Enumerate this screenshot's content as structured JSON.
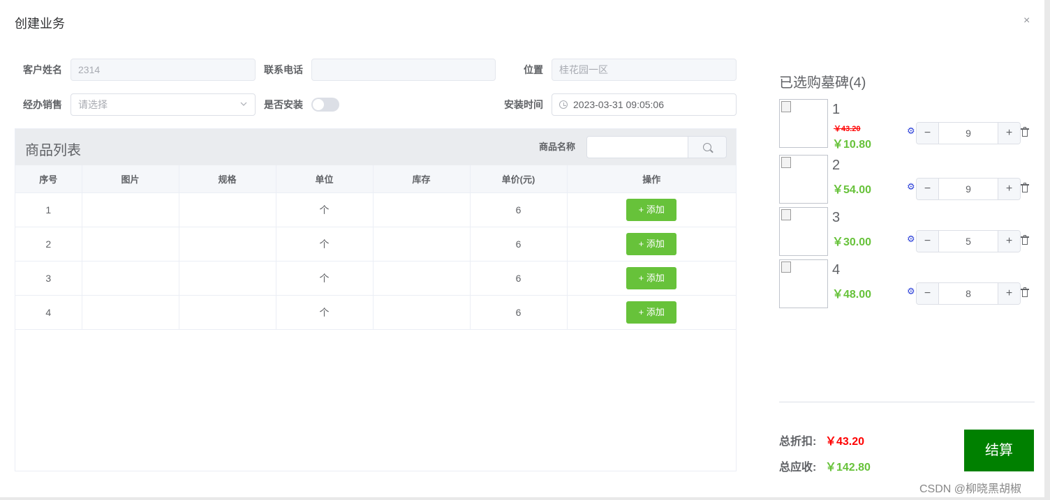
{
  "dialog": {
    "title": "创建业务",
    "close_icon": "×"
  },
  "form": {
    "customer_name": {
      "label": "客户姓名",
      "value": "2314"
    },
    "phone": {
      "label": "联系电话",
      "value": ""
    },
    "location": {
      "label": "位置",
      "value": "桂花园一区"
    },
    "salesperson": {
      "label": "经办销售",
      "placeholder": "请选择"
    },
    "install": {
      "label": "是否安装",
      "on": false
    },
    "install_time": {
      "label": "安装时间",
      "value": "2023-03-31 09:05:06"
    }
  },
  "product_list": {
    "title": "商品列表",
    "search_label": "商品名称",
    "search_value": "",
    "columns": [
      "序号",
      "图片",
      "规格",
      "单位",
      "库存",
      "单价(元)",
      "操作"
    ],
    "add_label": "+ 添加",
    "rows": [
      {
        "index": "1",
        "spec": "",
        "unit": "个",
        "stock": "",
        "price": "6"
      },
      {
        "index": "2",
        "spec": "",
        "unit": "个",
        "stock": "",
        "price": "6"
      },
      {
        "index": "3",
        "spec": "",
        "unit": "个",
        "stock": "",
        "price": "6"
      },
      {
        "index": "4",
        "spec": "",
        "unit": "个",
        "stock": "",
        "price": "6"
      }
    ]
  },
  "cart": {
    "title": "已选购墓碑(4)",
    "items": [
      {
        "name": "1",
        "original_price": "￥43.20",
        "price": "￥10.80",
        "qty": "9"
      },
      {
        "name": "2",
        "original_price": "",
        "price": "￥54.00",
        "qty": "9"
      },
      {
        "name": "3",
        "original_price": "",
        "price": "￥30.00",
        "qty": "5"
      },
      {
        "name": "4",
        "original_price": "",
        "price": "￥48.00",
        "qty": "8"
      }
    ],
    "minus": "−",
    "plus": "+"
  },
  "totals": {
    "discount_label": "总折扣:",
    "discount_value": "￥43.20",
    "receivable_label": "总应收:",
    "receivable_value": "￥142.80",
    "checkout_label": "结算"
  },
  "watermark": "CSDN @柳晓黑胡椒",
  "colors": {
    "accent_green": "#67c23a",
    "checkout_green": "#008000",
    "discount_red": "#ff0000"
  }
}
